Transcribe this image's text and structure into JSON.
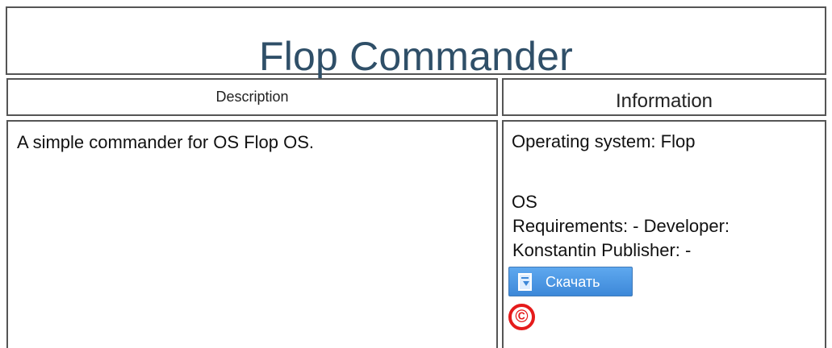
{
  "page": {
    "title": "Flop Commander",
    "headers": {
      "description": "Description",
      "information": "Information"
    },
    "description": {
      "text": "A simple commander for OS Flop OS."
    },
    "information": {
      "operating_system_line1": "Operating system: Flop",
      "operating_system_line2": "OS",
      "requirements_line1": "Requirements: - Developer:",
      "requirements_line2": "Konstantin Publisher: -",
      "download_button": "Скачать",
      "copyright_symbol": "©"
    },
    "icons": {
      "download": "download-icon",
      "copyright": "copyright-icon"
    },
    "colors": {
      "title": "#2f4f68",
      "border": "#555555",
      "download_button": "#3d88d8",
      "copyright_icon": "#e51b1b"
    }
  }
}
